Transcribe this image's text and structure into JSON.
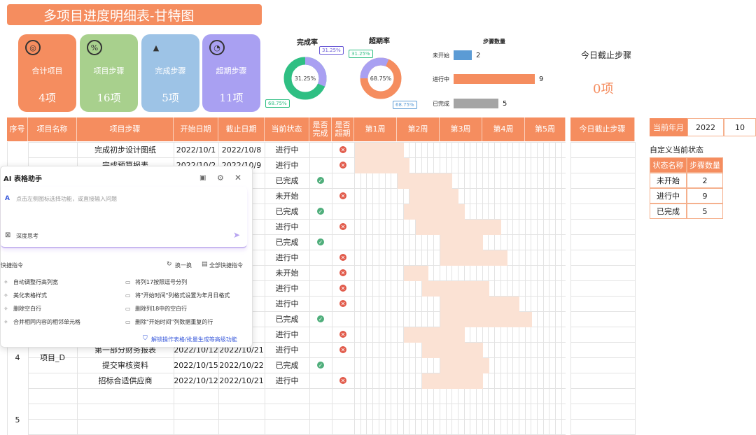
{
  "title": "多项目进度明细表-甘特图",
  "cards": [
    {
      "label": "合计项目",
      "value": "4项",
      "color": "#f58d5f",
      "icon": "lifebuoy-icon"
    },
    {
      "label": "项目步骤",
      "value": "16项",
      "color": "#a8d08d",
      "icon": "percent-icon"
    },
    {
      "label": "完成步骤",
      "value": "5项",
      "color": "#9dc3e6",
      "icon": "mountain-icon"
    },
    {
      "label": "超期步骤",
      "value": "11项",
      "color": "#a9a0f2",
      "icon": "pie-icon"
    }
  ],
  "rings": {
    "completion": {
      "title": "完成率",
      "center": "31.25%",
      "callout_top": "31.25%",
      "callout_bottom": "68.75%",
      "value_pct": 31.25
    },
    "overdue": {
      "title": "超期率",
      "center": "68.75%",
      "callout_top": "31.25%",
      "callout_bottom": "68.75%",
      "value_pct": 68.75
    }
  },
  "chart_data": {
    "type": "bar",
    "title": "步骤数量",
    "categories": [
      "未开始",
      "进行中",
      "已完成"
    ],
    "values": [
      2,
      9,
      5
    ],
    "colors": [
      "#5b9bd5",
      "#f58d5f",
      "#a5a5a5"
    ]
  },
  "today_step": {
    "title": "今日截止步骤",
    "value": "0项"
  },
  "table": {
    "headers": [
      "序号",
      "项目名称",
      "项目步骤",
      "开始日期",
      "截止日期",
      "当前状态",
      "是否完成",
      "是否超期",
      "第1周",
      "第2周",
      "第3周",
      "第4周",
      "第5周",
      "今日截止步骤"
    ],
    "rows": [
      {
        "step": "完成初步设计图纸",
        "start": "2022/10/1",
        "end": "2022/10/8",
        "status": "进行中",
        "done": "",
        "over": "x"
      },
      {
        "step": "完成预算报表",
        "start": "2022/10/2",
        "end": "2022/10/9",
        "status": "进行中",
        "done": "",
        "over": "x"
      },
      {
        "step": "",
        "start": "",
        "end": "/15",
        "status": "已完成",
        "done": "ok",
        "over": ""
      },
      {
        "step": "",
        "start": "",
        "end": "/24",
        "status": "未开始",
        "done": "",
        "over": "x"
      },
      {
        "step": "",
        "start": "",
        "end": "/18",
        "status": "已完成",
        "done": "ok",
        "over": ""
      },
      {
        "step": "",
        "start": "",
        "end": "/23",
        "status": "进行中",
        "done": "",
        "over": "x"
      },
      {
        "step": "",
        "start": "",
        "end": "/21",
        "status": "已完成",
        "done": "ok",
        "over": ""
      },
      {
        "step": "",
        "start": "",
        "end": "/24",
        "status": "进行中",
        "done": "",
        "over": "x"
      },
      {
        "step": "",
        "start": "",
        "end": "/12",
        "status": "未开始",
        "done": "",
        "over": "x"
      },
      {
        "step": "",
        "start": "",
        "end": "/22",
        "status": "进行中",
        "done": "",
        "over": "x"
      },
      {
        "step": "",
        "start": "",
        "end": "/27",
        "status": "进行中",
        "done": "",
        "over": "x"
      },
      {
        "step": "",
        "start": "",
        "end": "/29",
        "status": "已完成",
        "done": "ok",
        "over": ""
      },
      {
        "step": "",
        "start": "",
        "end": "/18",
        "status": "进行中",
        "done": "",
        "over": "x"
      },
      {
        "step": "第一部分财务报表",
        "start": "2022/10/12",
        "end": "2022/10/21",
        "status": "进行中",
        "done": "",
        "over": "x"
      },
      {
        "step": "提交审核资料",
        "start": "2022/10/15",
        "end": "2022/10/22",
        "status": "已完成",
        "done": "ok",
        "over": ""
      },
      {
        "step": "招标合适供应商",
        "start": "2022/10/12",
        "end": "2022/10/21",
        "status": "进行中",
        "done": "",
        "over": "x"
      }
    ],
    "project_d": {
      "index": "4",
      "name": "项目_D"
    },
    "row5_index": "5"
  },
  "current_month": {
    "label": "当前年月",
    "year": "2022",
    "month": "10"
  },
  "custom_status": {
    "title": "自定义当前状态",
    "headers": [
      "状态名称",
      "步骤数量"
    ],
    "rows": [
      [
        "未开始",
        "2"
      ],
      [
        "进行中",
        "9"
      ],
      [
        "已完成",
        "5"
      ]
    ]
  },
  "ai_panel": {
    "title": "AI 表格助手",
    "placeholder": "点击左侧图标选择功能，或直接输入问题",
    "deep_think": "深度思考",
    "quick_title": "快捷指令",
    "switch": "换一换",
    "all_quick": "全部快捷指令",
    "commands": [
      "自动调整行高列宽",
      "将列17按照逗号分列",
      "美化表格样式",
      "将\"开始时间\"列格式设置为年月日格式",
      "删除空白行",
      "删除列18中的空白行",
      "合并相同内容的相邻单元格",
      "删除\"开始时间\"列数据重复的行"
    ],
    "unlock": "解锁操作表格/批量生成等高级功能"
  }
}
